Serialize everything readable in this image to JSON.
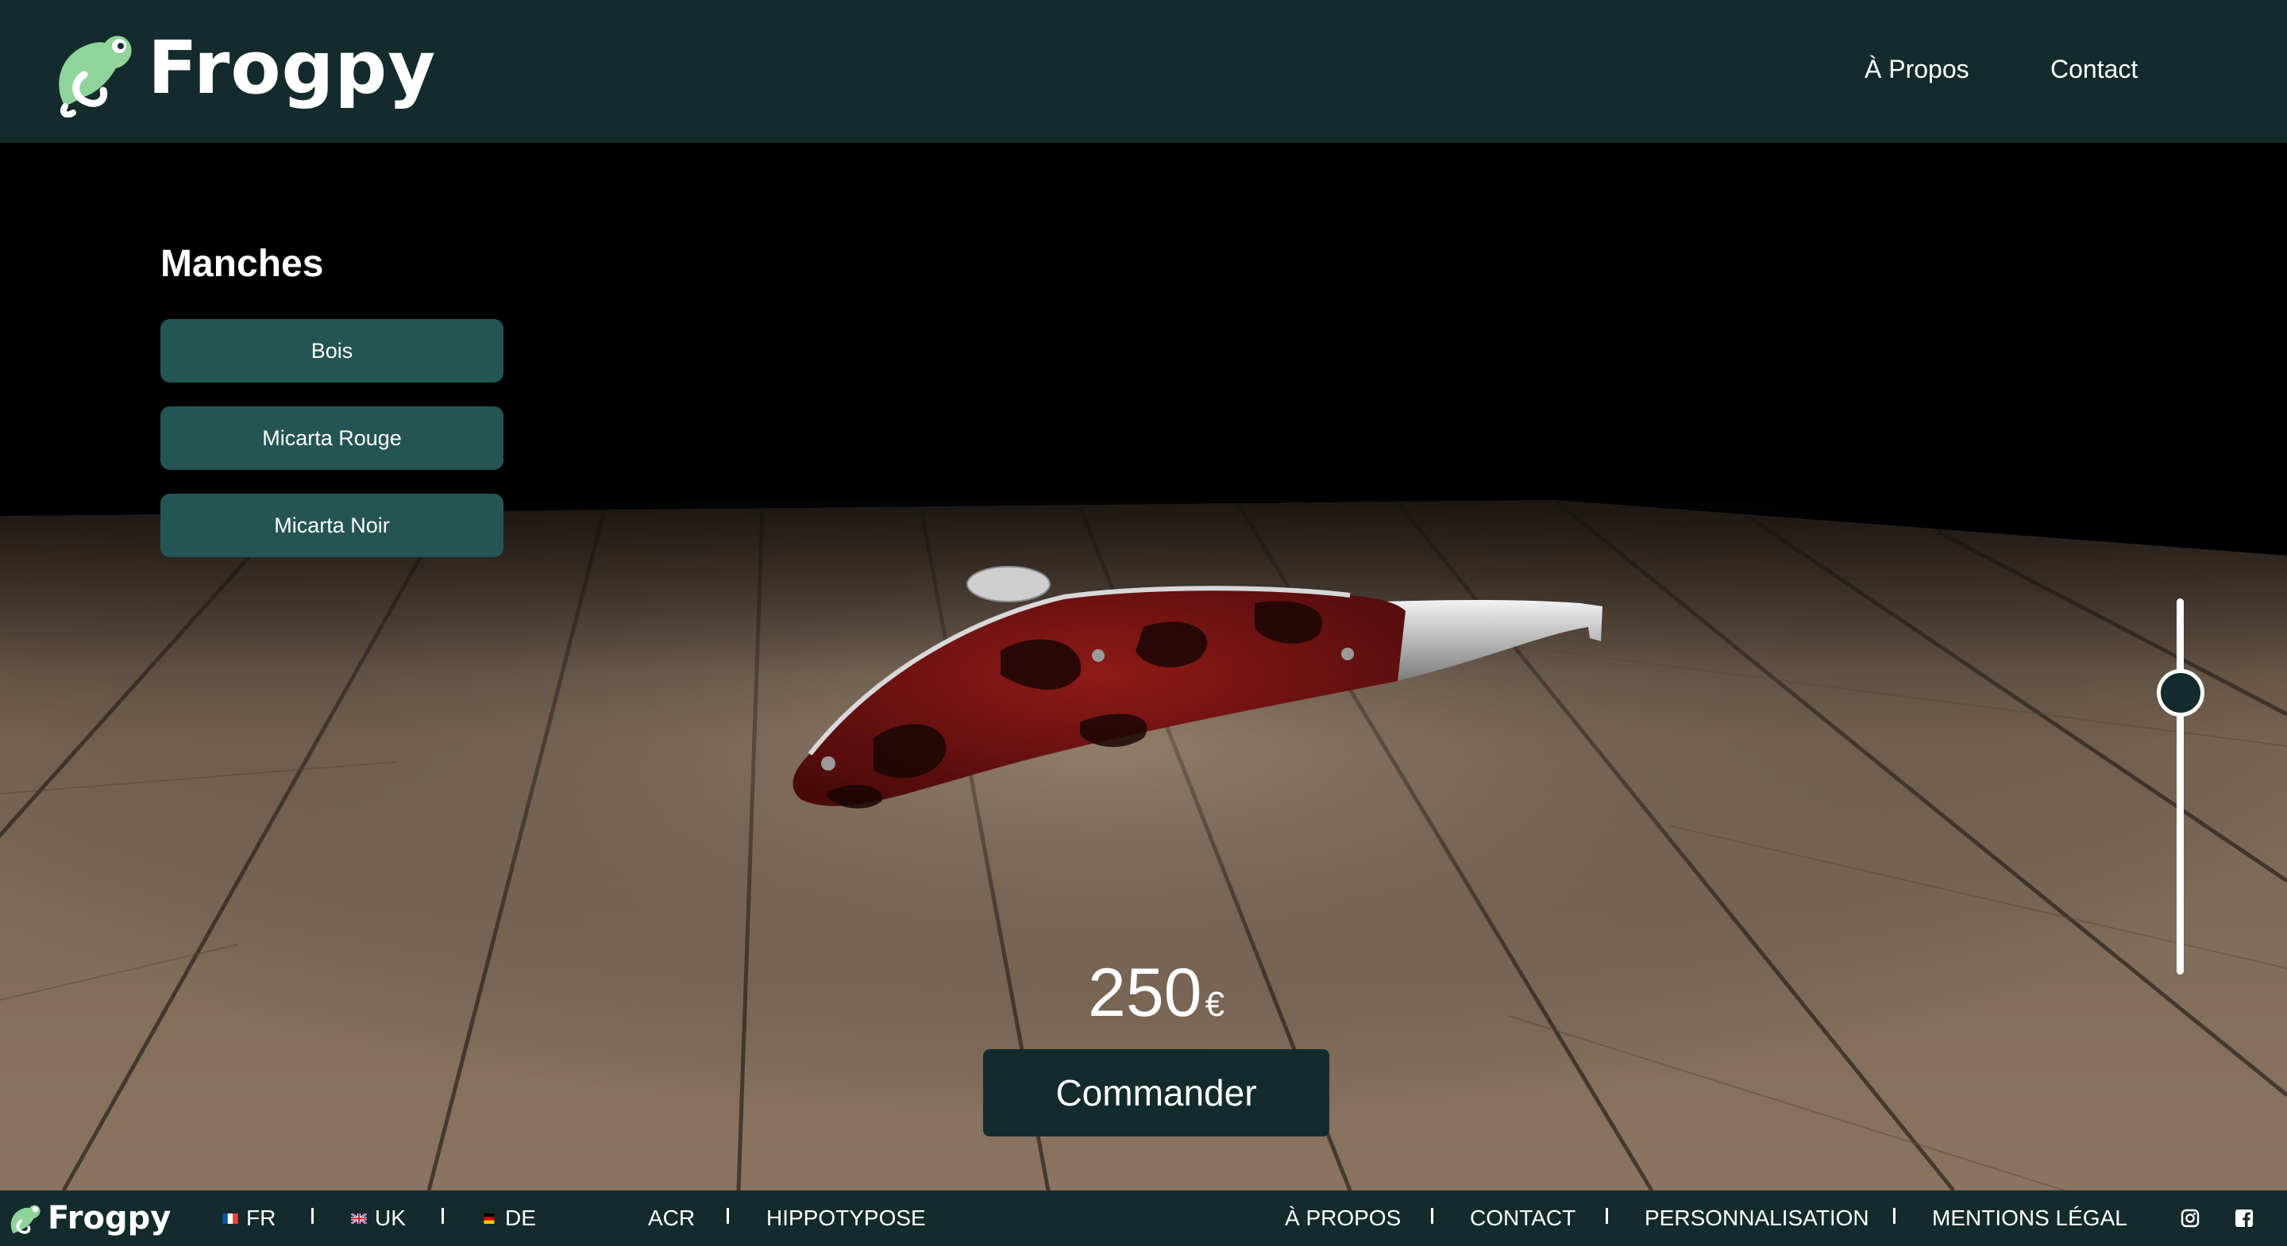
{
  "header": {
    "logo_text": "Frogpy",
    "nav": {
      "about": "À Propos",
      "contact": "Contact"
    }
  },
  "sidebar": {
    "title": "Manches",
    "options": [
      {
        "label": "Bois"
      },
      {
        "label": "Micarta Rouge"
      },
      {
        "label": "Micarta Noir"
      }
    ]
  },
  "product": {
    "price": "250",
    "currency": "€",
    "order_label": "Commander",
    "zoom_level": 0.75
  },
  "footer": {
    "logo_text": "Frogpy",
    "languages": [
      {
        "code": "FR",
        "flag": "fr-flag-icon"
      },
      {
        "code": "UK",
        "flag": "uk-flag-icon"
      },
      {
        "code": "DE",
        "flag": "de-flag-icon"
      }
    ],
    "links_left": [
      "ACR",
      "HIPPOTYPOSE"
    ],
    "links_right": [
      "À PROPOS",
      "CONTACT",
      "PERSONNALISATION",
      "MENTIONS LÉGAL"
    ],
    "social": [
      "instagram-icon",
      "facebook-icon"
    ]
  },
  "colors": {
    "header_bg": "#142b2e",
    "button_bg": "#245453",
    "frog_green": "#8fd49a",
    "handle_red": "#7a1414"
  }
}
